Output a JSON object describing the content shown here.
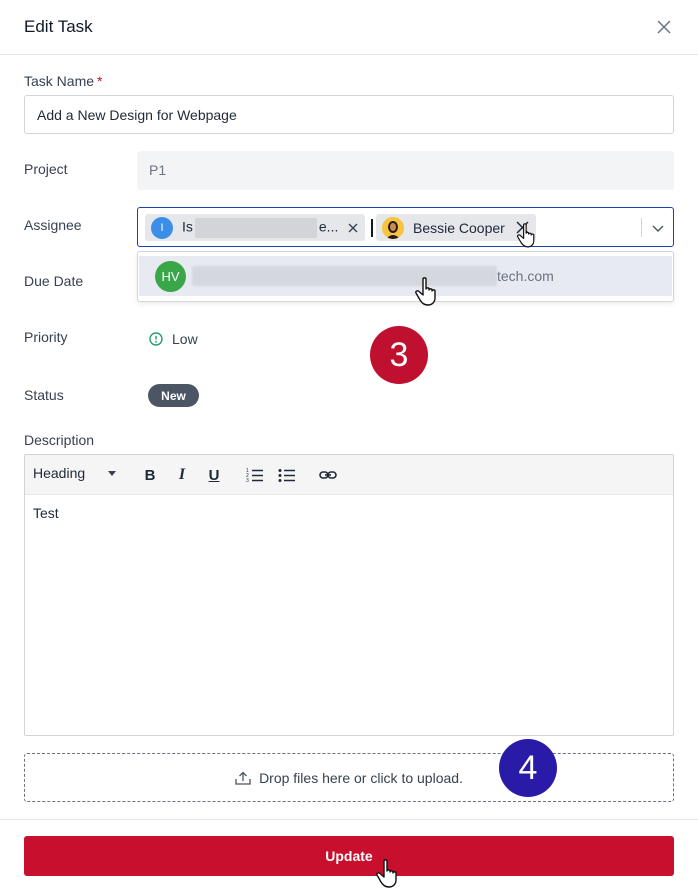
{
  "modal": {
    "title": "Edit Task"
  },
  "fields": {
    "task_name_label": "Task Name",
    "required_mark": "*",
    "task_name_value": "Add a New Design for Webpage",
    "project_label": "Project",
    "project_value": "P1",
    "assignee_label": "Assignee",
    "due_date_label": "Due Date",
    "priority_label": "Priority",
    "priority_value": "Low",
    "status_label": "Status",
    "status_value": "New",
    "description_label": "Description"
  },
  "assignees": {
    "chips": [
      {
        "avatar_initial": "I",
        "text_start": "Is",
        "text_end": "e..."
      },
      {
        "name": "Bessie Cooper"
      }
    ],
    "dropdown_option": {
      "avatar_initials": "HV",
      "suffix": "tech.com"
    }
  },
  "editor": {
    "heading_select": "Heading",
    "content": "Test"
  },
  "upload": {
    "text": "Drop files here or click to upload."
  },
  "footer": {
    "update_label": "Update"
  },
  "annotations": {
    "step_3": "3",
    "step_4": "4"
  },
  "colors": {
    "primary": "#c8102e",
    "focus_border": "#1e40af",
    "status_badge": "#4b5563",
    "step3_badge": "#c0102f",
    "step4_badge": "#2a1aa8",
    "avatar_blue": "#3b8fe8",
    "avatar_green": "#3aa64a"
  }
}
